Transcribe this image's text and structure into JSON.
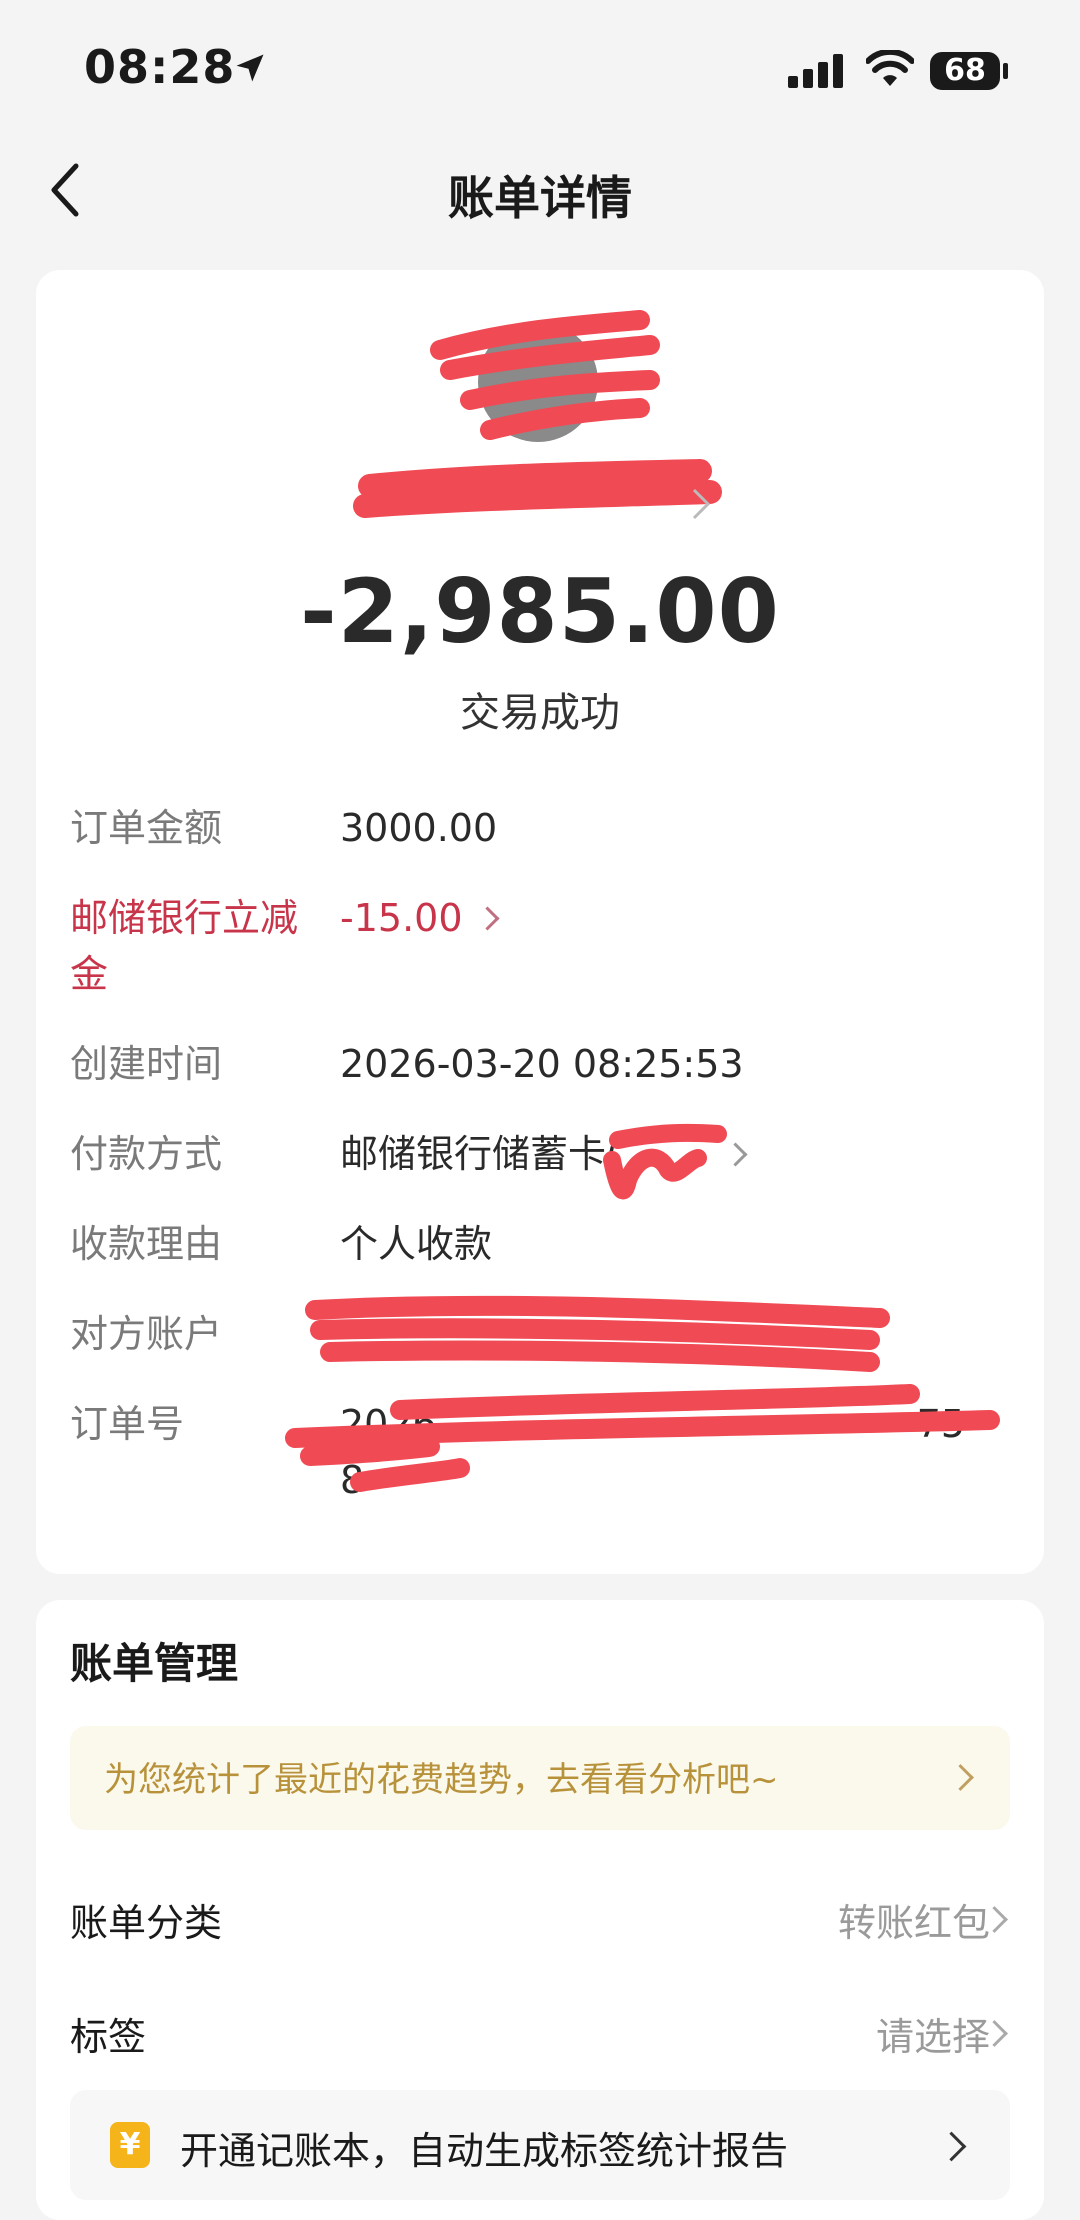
{
  "status_bar": {
    "time": "08:28",
    "battery": "68"
  },
  "nav": {
    "title": "账单详情"
  },
  "summary": {
    "amount": "-2,985.00",
    "status": "交易成功"
  },
  "details": [
    {
      "label": "订单金额",
      "value": "3000.00"
    },
    {
      "label": "邮储银行立减金",
      "value": "-15.00"
    },
    {
      "label": "创建时间",
      "value": "2026-03-20 08:25:53"
    },
    {
      "label": "付款方式",
      "value": "邮储银行储蓄卡("
    },
    {
      "label": "收款理由",
      "value": "个人收款"
    },
    {
      "label": "对方账户",
      "value": ""
    },
    {
      "label": "订单号",
      "value": "2026",
      "value_tail": "75",
      "value_line2": "8"
    }
  ],
  "management": {
    "title": "账单管理",
    "promo": "为您统计了最近的花费趋势，去看看分析吧~",
    "category_label": "账单分类",
    "category_value": "转账红包",
    "tag_label": "标签",
    "tag_value": "请选择",
    "ledger_icon": "¥",
    "ledger_promo": "开通记账本，自动生成标签统计报告"
  },
  "icons": [
    "location-arrow-icon",
    "signal-icon",
    "wifi-icon",
    "back-icon",
    "chevron-right-icon",
    "yen-icon"
  ],
  "colors": {
    "accent_red": "#c8354a",
    "redaction": "#f04a54",
    "promo_text": "#b8923a",
    "ledger_icon": "#f5b41a"
  }
}
